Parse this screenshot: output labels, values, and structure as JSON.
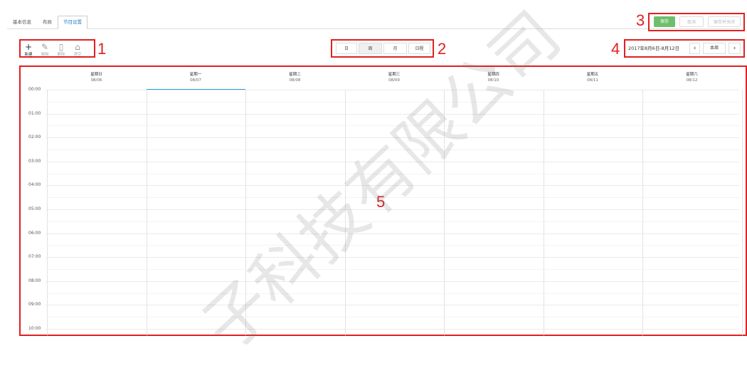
{
  "tabs": [
    "基本信息",
    "布局",
    "节目设置"
  ],
  "toolbar": [
    {
      "label": "新建",
      "icon": "plus-icon"
    },
    {
      "label": "编辑",
      "icon": "edit-icon"
    },
    {
      "label": "删除",
      "icon": "trash-icon"
    },
    {
      "label": "清空",
      "icon": "clear-icon"
    }
  ],
  "views": [
    "日",
    "周",
    "月",
    "日程"
  ],
  "actions": {
    "save": "保存",
    "cancel": "取消",
    "save_close": "保存并关闭"
  },
  "nav": {
    "date_range": "2017年8月6日-8月12日",
    "prev": "‹",
    "this_week": "本周",
    "next": "›"
  },
  "days": [
    {
      "name": "星期日",
      "date": "08/06"
    },
    {
      "name": "星期一",
      "date": "08/07"
    },
    {
      "name": "星期二",
      "date": "08/08"
    },
    {
      "name": "星期三",
      "date": "08/09"
    },
    {
      "name": "星期四",
      "date": "08/10"
    },
    {
      "name": "星期五",
      "date": "08/11"
    },
    {
      "name": "星期六",
      "date": "08/12"
    }
  ],
  "times": [
    "00:00",
    "01:00",
    "02:00",
    "03:00",
    "04:00",
    "05:00",
    "06:00",
    "07:00",
    "08:00",
    "09:00",
    "10:00"
  ],
  "annotations": [
    "1",
    "2",
    "3",
    "4",
    "5"
  ],
  "colors": {
    "accent": "#2ba0d8",
    "save_green": "#5cb85c",
    "annotation_red": "#e02020"
  },
  "watermark": "子科技有限公司"
}
